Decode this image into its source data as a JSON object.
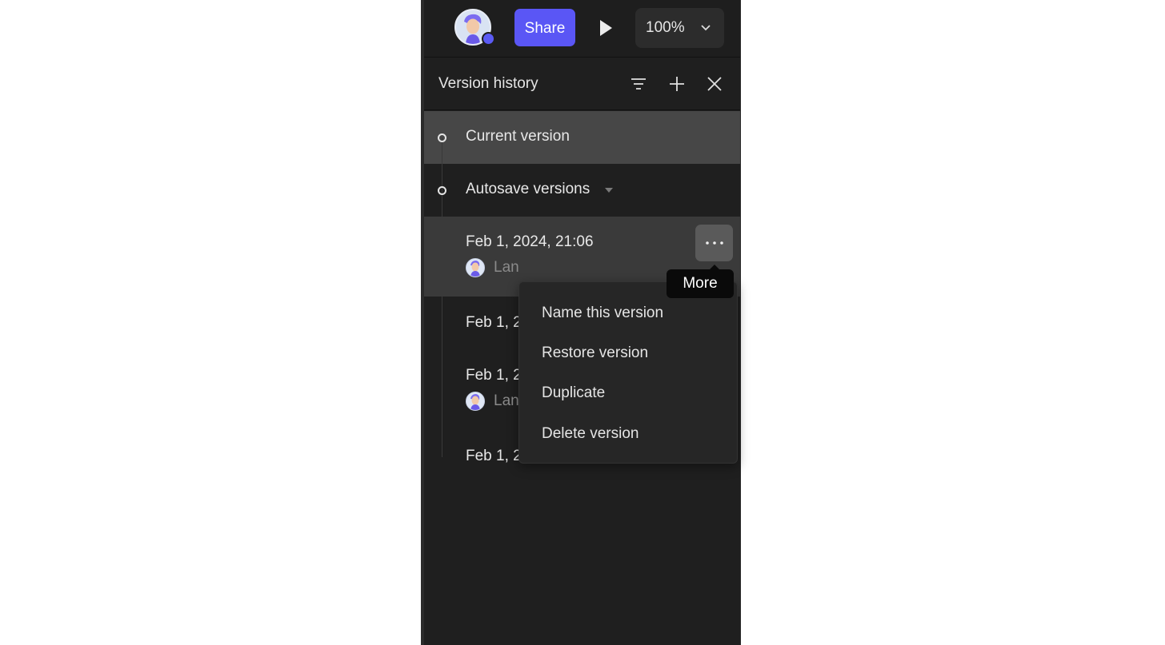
{
  "toolbar": {
    "share_label": "Share",
    "zoom_value": "100%",
    "accent_color": "#5a56f5"
  },
  "version_history": {
    "title": "Version history",
    "header_icons": [
      "filter-icon",
      "plus-icon",
      "close-icon"
    ],
    "current_version_label": "Current version",
    "autosave_label": "Autosave versions",
    "versions": [
      {
        "timestamp": "Feb 1, 2024, 21:06",
        "author": "Lan"
      },
      {
        "timestamp": "Feb 1, 2",
        "author": ""
      },
      {
        "timestamp": "Feb 1, 2",
        "author": "Lan"
      },
      {
        "timestamp": "Feb 1, 2",
        "author": ""
      }
    ]
  },
  "tooltip": {
    "label": "More"
  },
  "context_menu": {
    "items": [
      {
        "label": "Name this version"
      },
      {
        "label": "Restore version"
      },
      {
        "label": "Duplicate"
      },
      {
        "label": "Delete version"
      }
    ]
  }
}
